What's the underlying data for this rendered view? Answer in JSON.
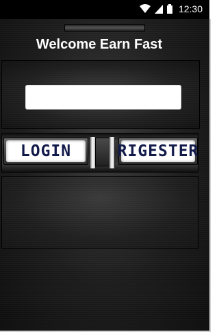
{
  "status_bar": {
    "time": "12:30",
    "icons": [
      "wifi-icon",
      "signal-icon",
      "battery-icon"
    ]
  },
  "app": {
    "title": "Welcome Earn Fast",
    "input": {
      "value": "",
      "placeholder": ""
    },
    "login_label": "LOGIN",
    "register_label": "RIGESTER"
  }
}
